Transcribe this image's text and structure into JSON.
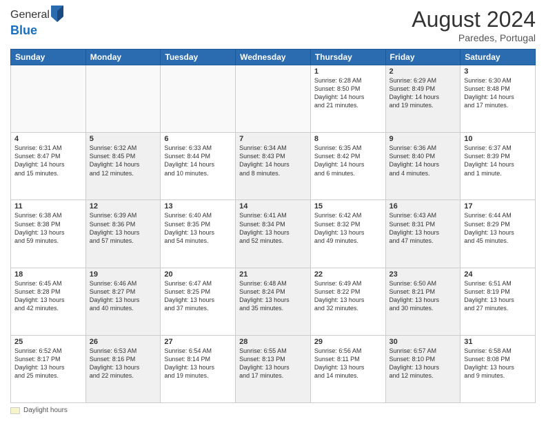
{
  "header": {
    "logo_line1": "General",
    "logo_line2": "Blue",
    "month_year": "August 2024",
    "location": "Paredes, Portugal"
  },
  "weekdays": [
    "Sunday",
    "Monday",
    "Tuesday",
    "Wednesday",
    "Thursday",
    "Friday",
    "Saturday"
  ],
  "weeks": [
    [
      {
        "day": "",
        "info": "",
        "shaded": false,
        "empty": true
      },
      {
        "day": "",
        "info": "",
        "shaded": false,
        "empty": true
      },
      {
        "day": "",
        "info": "",
        "shaded": false,
        "empty": true
      },
      {
        "day": "",
        "info": "",
        "shaded": false,
        "empty": true
      },
      {
        "day": "1",
        "info": "Sunrise: 6:28 AM\nSunset: 8:50 PM\nDaylight: 14 hours\nand 21 minutes.",
        "shaded": false,
        "empty": false
      },
      {
        "day": "2",
        "info": "Sunrise: 6:29 AM\nSunset: 8:49 PM\nDaylight: 14 hours\nand 19 minutes.",
        "shaded": true,
        "empty": false
      },
      {
        "day": "3",
        "info": "Sunrise: 6:30 AM\nSunset: 8:48 PM\nDaylight: 14 hours\nand 17 minutes.",
        "shaded": false,
        "empty": false
      }
    ],
    [
      {
        "day": "4",
        "info": "Sunrise: 6:31 AM\nSunset: 8:47 PM\nDaylight: 14 hours\nand 15 minutes.",
        "shaded": false,
        "empty": false
      },
      {
        "day": "5",
        "info": "Sunrise: 6:32 AM\nSunset: 8:45 PM\nDaylight: 14 hours\nand 12 minutes.",
        "shaded": true,
        "empty": false
      },
      {
        "day": "6",
        "info": "Sunrise: 6:33 AM\nSunset: 8:44 PM\nDaylight: 14 hours\nand 10 minutes.",
        "shaded": false,
        "empty": false
      },
      {
        "day": "7",
        "info": "Sunrise: 6:34 AM\nSunset: 8:43 PM\nDaylight: 14 hours\nand 8 minutes.",
        "shaded": true,
        "empty": false
      },
      {
        "day": "8",
        "info": "Sunrise: 6:35 AM\nSunset: 8:42 PM\nDaylight: 14 hours\nand 6 minutes.",
        "shaded": false,
        "empty": false
      },
      {
        "day": "9",
        "info": "Sunrise: 6:36 AM\nSunset: 8:40 PM\nDaylight: 14 hours\nand 4 minutes.",
        "shaded": true,
        "empty": false
      },
      {
        "day": "10",
        "info": "Sunrise: 6:37 AM\nSunset: 8:39 PM\nDaylight: 14 hours\nand 1 minute.",
        "shaded": false,
        "empty": false
      }
    ],
    [
      {
        "day": "11",
        "info": "Sunrise: 6:38 AM\nSunset: 8:38 PM\nDaylight: 13 hours\nand 59 minutes.",
        "shaded": false,
        "empty": false
      },
      {
        "day": "12",
        "info": "Sunrise: 6:39 AM\nSunset: 8:36 PM\nDaylight: 13 hours\nand 57 minutes.",
        "shaded": true,
        "empty": false
      },
      {
        "day": "13",
        "info": "Sunrise: 6:40 AM\nSunset: 8:35 PM\nDaylight: 13 hours\nand 54 minutes.",
        "shaded": false,
        "empty": false
      },
      {
        "day": "14",
        "info": "Sunrise: 6:41 AM\nSunset: 8:34 PM\nDaylight: 13 hours\nand 52 minutes.",
        "shaded": true,
        "empty": false
      },
      {
        "day": "15",
        "info": "Sunrise: 6:42 AM\nSunset: 8:32 PM\nDaylight: 13 hours\nand 49 minutes.",
        "shaded": false,
        "empty": false
      },
      {
        "day": "16",
        "info": "Sunrise: 6:43 AM\nSunset: 8:31 PM\nDaylight: 13 hours\nand 47 minutes.",
        "shaded": true,
        "empty": false
      },
      {
        "day": "17",
        "info": "Sunrise: 6:44 AM\nSunset: 8:29 PM\nDaylight: 13 hours\nand 45 minutes.",
        "shaded": false,
        "empty": false
      }
    ],
    [
      {
        "day": "18",
        "info": "Sunrise: 6:45 AM\nSunset: 8:28 PM\nDaylight: 13 hours\nand 42 minutes.",
        "shaded": false,
        "empty": false
      },
      {
        "day": "19",
        "info": "Sunrise: 6:46 AM\nSunset: 8:27 PM\nDaylight: 13 hours\nand 40 minutes.",
        "shaded": true,
        "empty": false
      },
      {
        "day": "20",
        "info": "Sunrise: 6:47 AM\nSunset: 8:25 PM\nDaylight: 13 hours\nand 37 minutes.",
        "shaded": false,
        "empty": false
      },
      {
        "day": "21",
        "info": "Sunrise: 6:48 AM\nSunset: 8:24 PM\nDaylight: 13 hours\nand 35 minutes.",
        "shaded": true,
        "empty": false
      },
      {
        "day": "22",
        "info": "Sunrise: 6:49 AM\nSunset: 8:22 PM\nDaylight: 13 hours\nand 32 minutes.",
        "shaded": false,
        "empty": false
      },
      {
        "day": "23",
        "info": "Sunrise: 6:50 AM\nSunset: 8:21 PM\nDaylight: 13 hours\nand 30 minutes.",
        "shaded": true,
        "empty": false
      },
      {
        "day": "24",
        "info": "Sunrise: 6:51 AM\nSunset: 8:19 PM\nDaylight: 13 hours\nand 27 minutes.",
        "shaded": false,
        "empty": false
      }
    ],
    [
      {
        "day": "25",
        "info": "Sunrise: 6:52 AM\nSunset: 8:17 PM\nDaylight: 13 hours\nand 25 minutes.",
        "shaded": false,
        "empty": false
      },
      {
        "day": "26",
        "info": "Sunrise: 6:53 AM\nSunset: 8:16 PM\nDaylight: 13 hours\nand 22 minutes.",
        "shaded": true,
        "empty": false
      },
      {
        "day": "27",
        "info": "Sunrise: 6:54 AM\nSunset: 8:14 PM\nDaylight: 13 hours\nand 19 minutes.",
        "shaded": false,
        "empty": false
      },
      {
        "day": "28",
        "info": "Sunrise: 6:55 AM\nSunset: 8:13 PM\nDaylight: 13 hours\nand 17 minutes.",
        "shaded": true,
        "empty": false
      },
      {
        "day": "29",
        "info": "Sunrise: 6:56 AM\nSunset: 8:11 PM\nDaylight: 13 hours\nand 14 minutes.",
        "shaded": false,
        "empty": false
      },
      {
        "day": "30",
        "info": "Sunrise: 6:57 AM\nSunset: 8:10 PM\nDaylight: 13 hours\nand 12 minutes.",
        "shaded": true,
        "empty": false
      },
      {
        "day": "31",
        "info": "Sunrise: 6:58 AM\nSunset: 8:08 PM\nDaylight: 13 hours\nand 9 minutes.",
        "shaded": false,
        "empty": false
      }
    ]
  ],
  "legend": {
    "label": "Daylight hours"
  }
}
